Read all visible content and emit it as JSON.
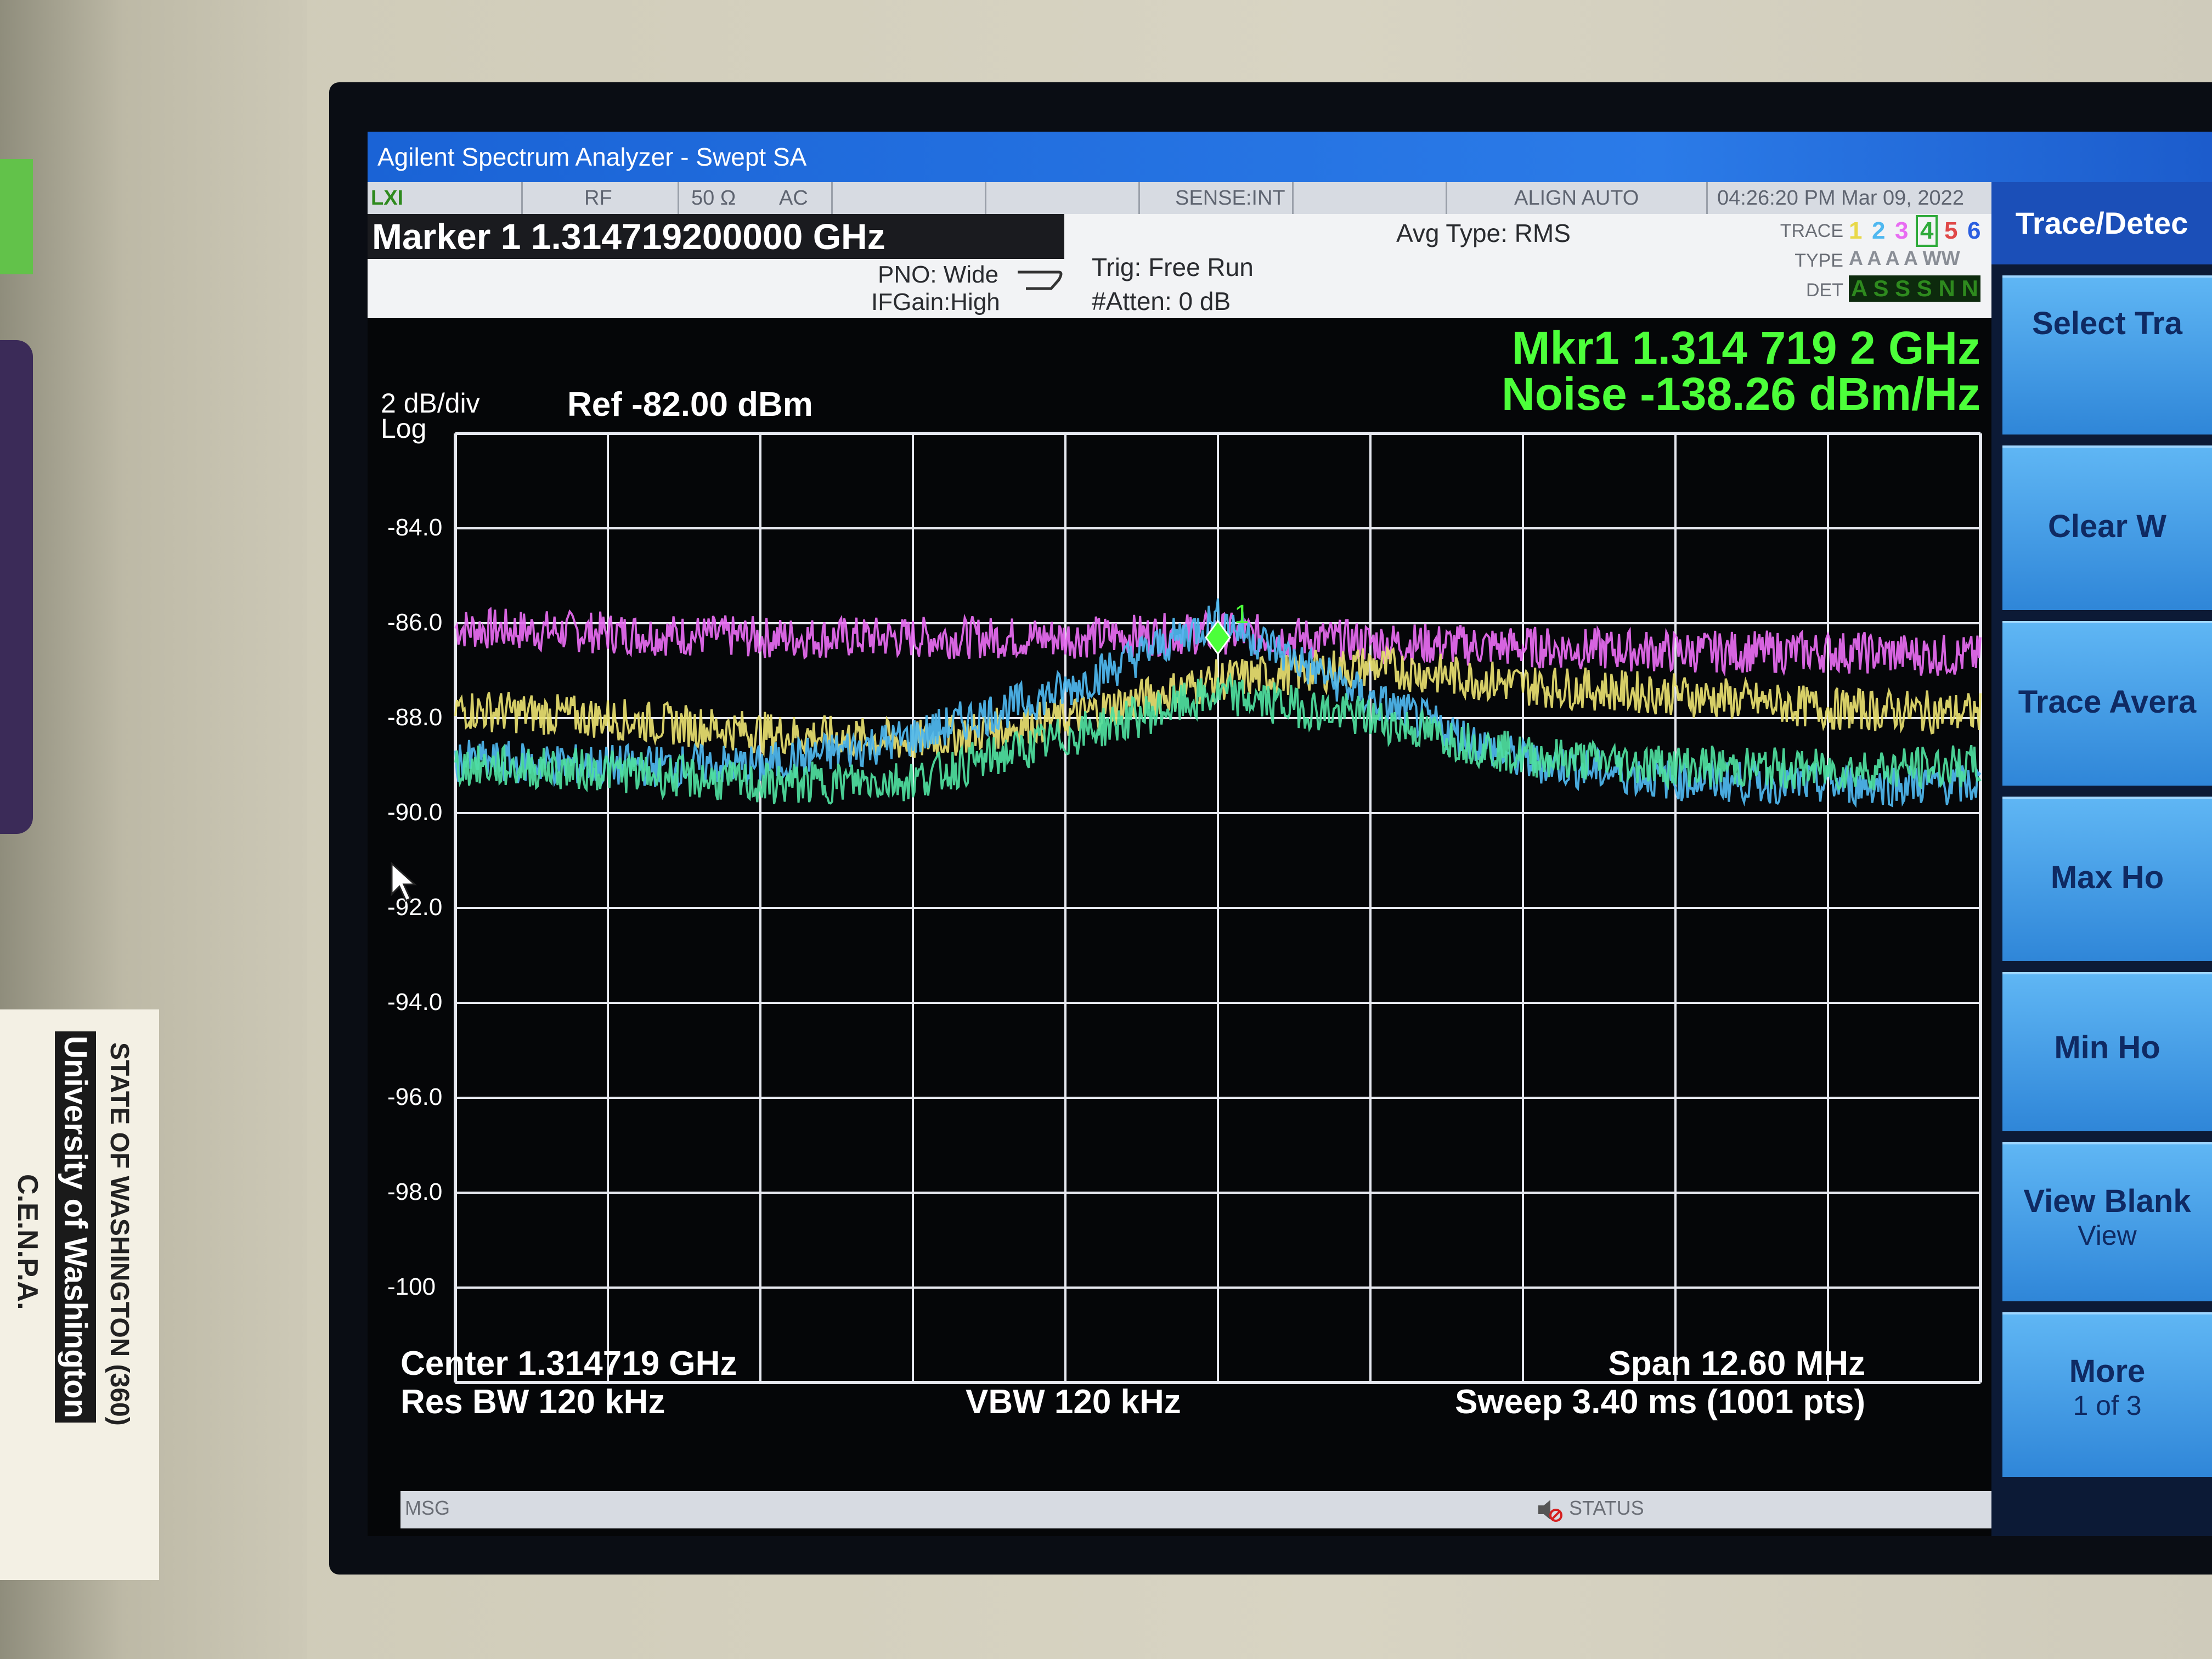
{
  "window": {
    "title": "Agilent Spectrum Analyzer - Swept SA"
  },
  "status_strip": {
    "lxi": "LXI",
    "rf": "RF",
    "impedance": "50 Ω",
    "coupling": "AC",
    "sense": "SENSE:INT",
    "align": "ALIGN AUTO",
    "datetime": "04:26:20 PM Mar 09, 2022"
  },
  "info_bar": {
    "marker_title": "Marker 1  1.314719200000 GHz",
    "pno": "PNO: Wide",
    "ifgain": "IFGain:High",
    "trig": "Trig: Free Run",
    "atten": "#Atten: 0 dB",
    "avg_type": "Avg Type: RMS",
    "trace_label": "TRACE",
    "type_label": "TYPE",
    "det_label": "DET",
    "trace_nums": [
      "1",
      "2",
      "3",
      "4",
      "5",
      "6"
    ],
    "type_row": "A A A A WW",
    "det_row": "A S S S N N"
  },
  "display": {
    "mkr_line1": "Mkr1  1.314 719 2 GHz",
    "mkr_line2": "Noise  -138.26 dBm/Hz",
    "scale": "2 dB/div",
    "scale_type": "Log",
    "ref": "Ref -82.00 dBm",
    "y_tick_labels": [
      "-84.0",
      "-86.0",
      "-88.0",
      "-90.0",
      "-92.0",
      "-94.0",
      "-96.0",
      "-98.0",
      "-100"
    ],
    "marker_label": "1",
    "center": "Center 1.314719 GHz",
    "span": "Span 12.60 MHz",
    "res_bw": "Res BW  120 kHz",
    "vbw": "VBW  120 kHz",
    "sweep": "Sweep  3.40 ms (1001 pts)"
  },
  "chart_data": {
    "type": "line",
    "ref_level_dbm": -82.0,
    "ylim": [
      -102,
      -82
    ],
    "x_center_ghz": 1.314719,
    "x_span_mhz": 12.6,
    "x": [
      -6.3,
      -5.04,
      -3.78,
      -2.52,
      -1.26,
      0,
      1.26,
      2.52,
      3.78,
      5.04,
      6.3
    ],
    "series": [
      {
        "color": "#e86cf2",
        "values": [
          -86.1,
          -86.2,
          -86.3,
          -86.3,
          -86.3,
          -86.2,
          -86.4,
          -86.5,
          -86.6,
          -86.6,
          -86.7
        ]
      },
      {
        "color": "#e8e070",
        "values": [
          -87.8,
          -88.0,
          -88.3,
          -88.5,
          -88.0,
          -87.2,
          -86.9,
          -87.3,
          -87.5,
          -87.8,
          -87.9
        ]
      },
      {
        "color": "#4fb8f0",
        "values": [
          -88.9,
          -89.0,
          -89.0,
          -88.4,
          -87.4,
          -85.9,
          -87.6,
          -88.9,
          -89.3,
          -89.4,
          -89.4
        ]
      },
      {
        "color": "#4fe0a0",
        "values": [
          -89.0,
          -89.1,
          -89.4,
          -89.3,
          -88.4,
          -87.5,
          -88.0,
          -88.8,
          -89.0,
          -89.1,
          -89.0
        ]
      }
    ],
    "marker": {
      "x": 0,
      "y": -86.3,
      "label": "1"
    }
  },
  "softkeys": {
    "title": "Trace/Detec",
    "items": [
      {
        "label": "Select Tra",
        "sub": ""
      },
      {
        "label": "Clear W",
        "sub": ""
      },
      {
        "label": "Trace Avera",
        "sub": ""
      },
      {
        "label": "Max Ho",
        "sub": ""
      },
      {
        "label": "Min Ho",
        "sub": ""
      },
      {
        "label": "View Blank",
        "sub": "View"
      },
      {
        "label": "More",
        "sub": "1 of 3"
      }
    ]
  },
  "msg_bar": {
    "msg": "MSG",
    "status": "STATUS"
  },
  "sticker": {
    "line1": "STATE OF WASHINGTON (360)",
    "line2": "University of Washington",
    "line3": "C.E.N.P.A."
  },
  "colors": {
    "marker_readout": "#4cff3a",
    "grid": "#e6e8ef",
    "title_bar": "#1f6ad9"
  }
}
